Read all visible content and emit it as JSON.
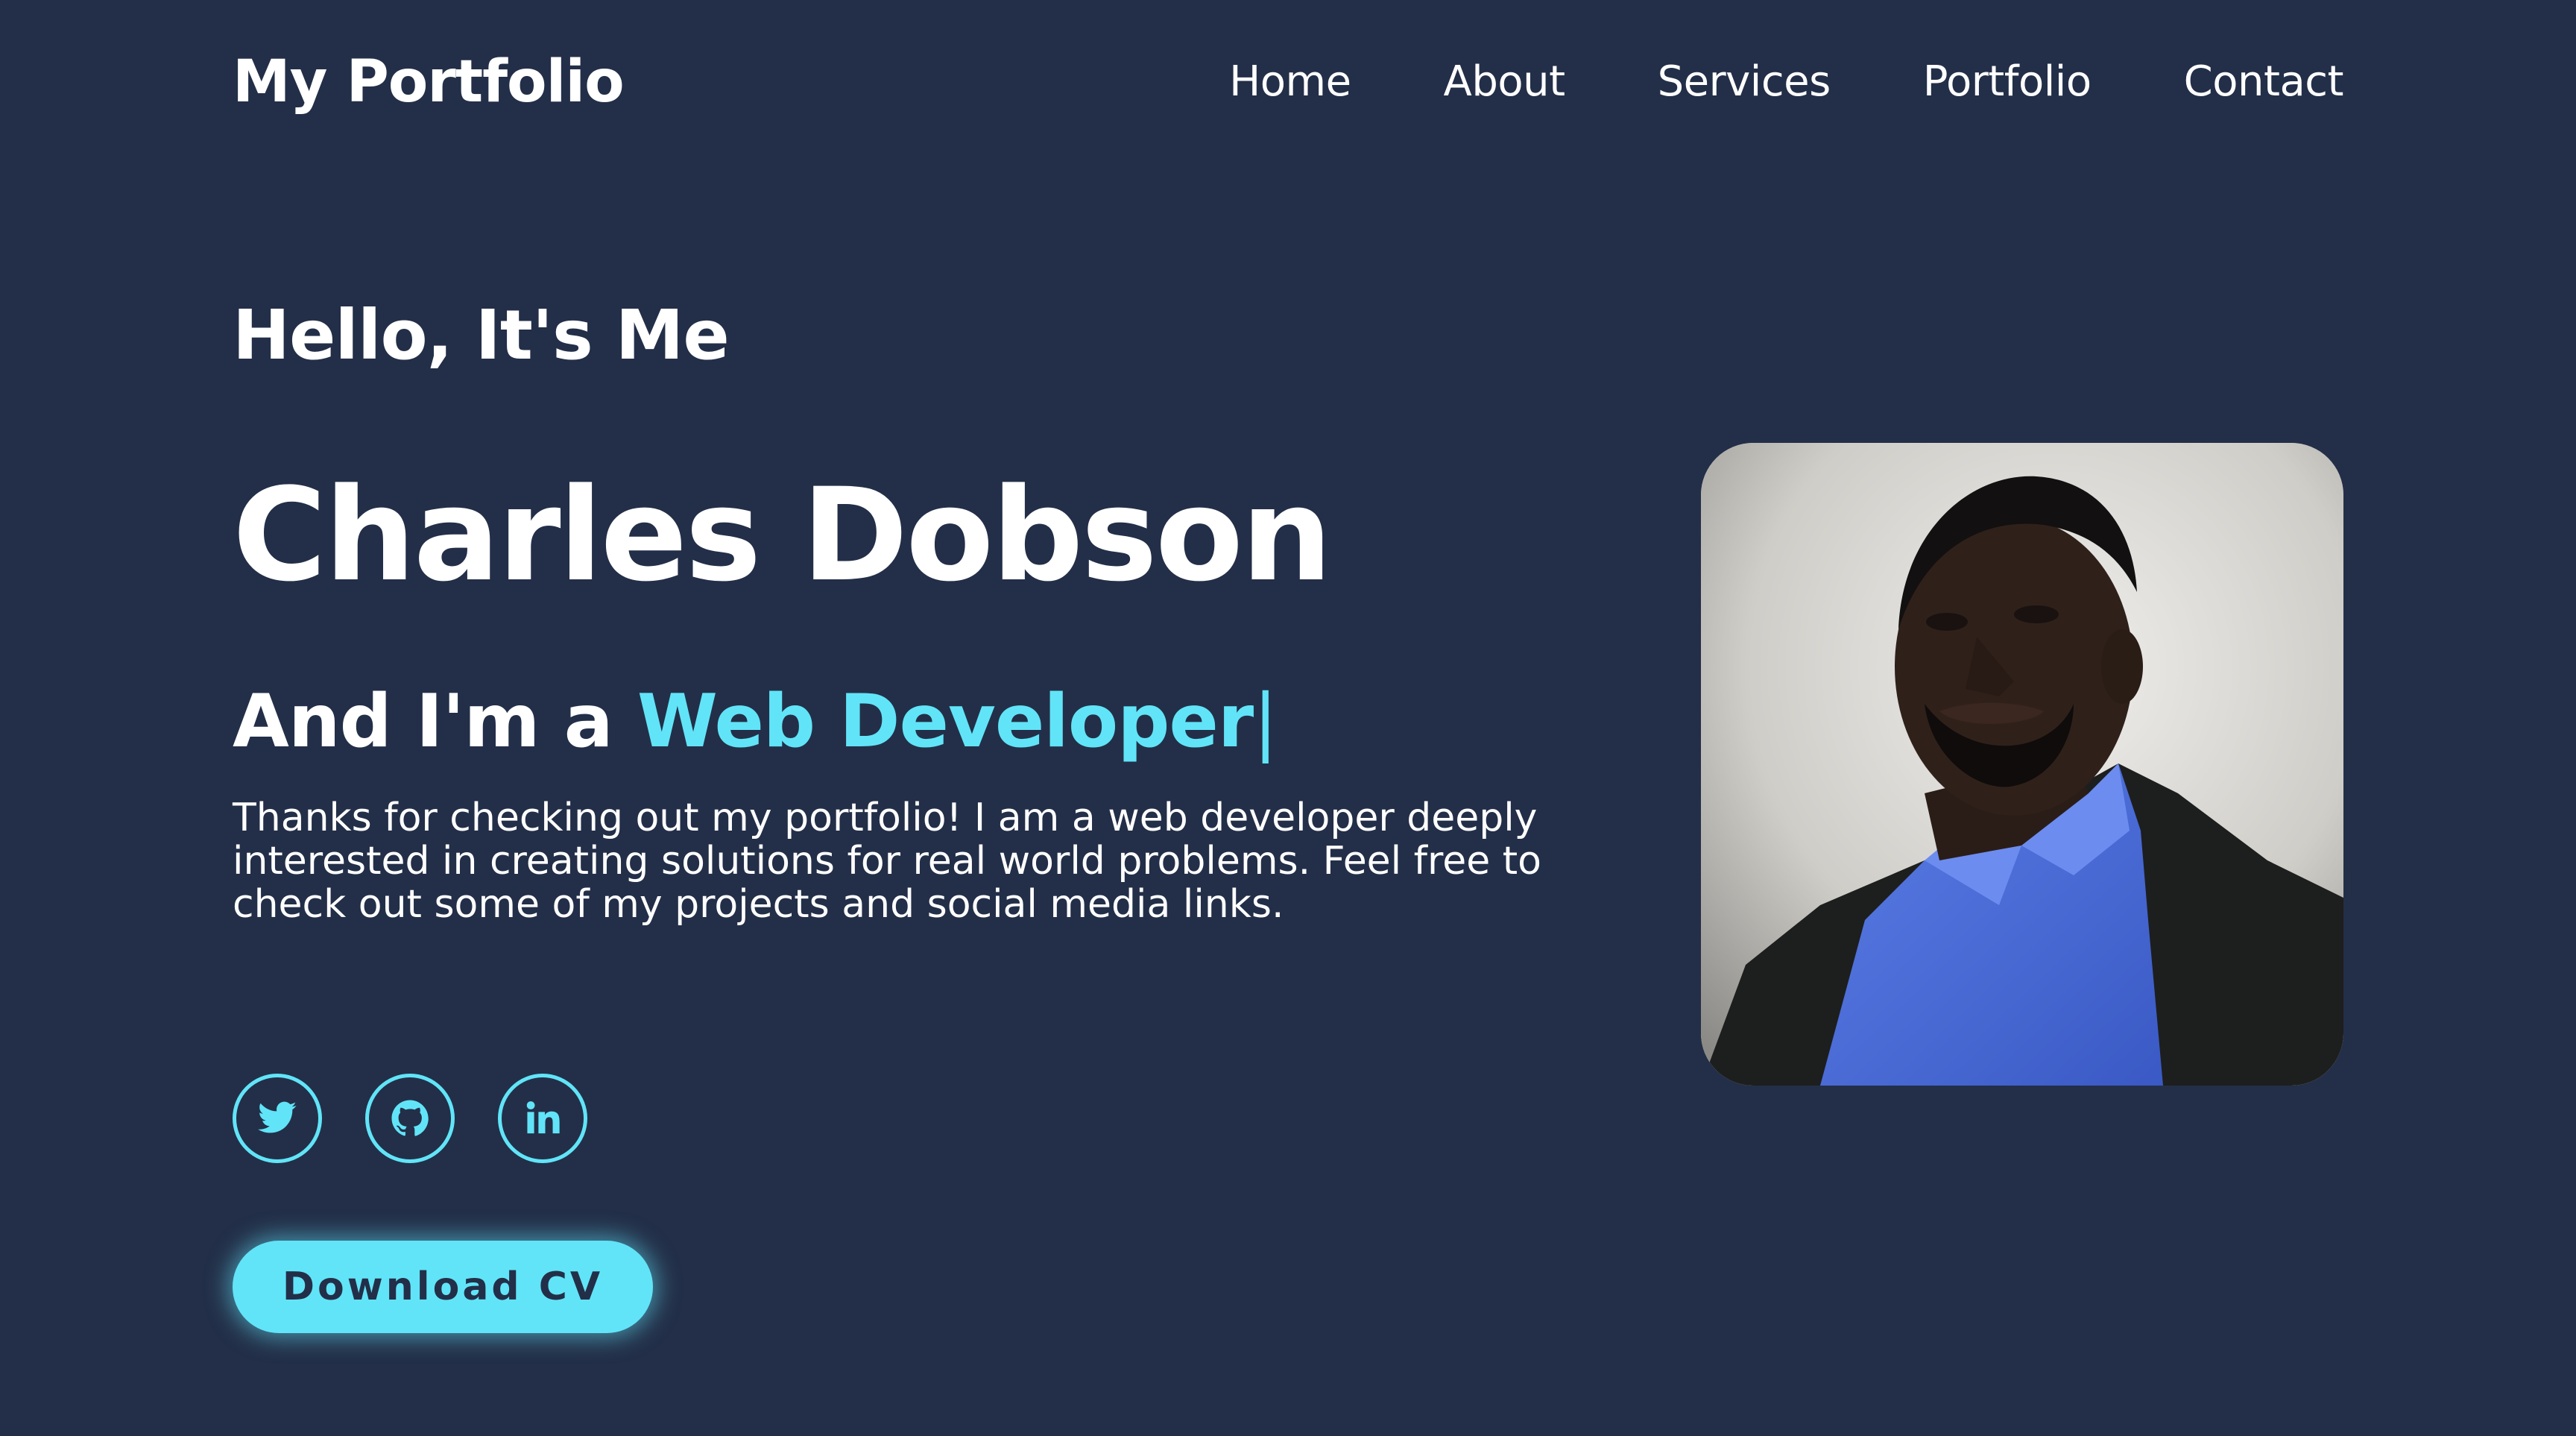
{
  "header": {
    "logo": "My Portfolio",
    "nav": [
      {
        "label": "Home"
      },
      {
        "label": "About"
      },
      {
        "label": "Services"
      },
      {
        "label": "Portfolio"
      },
      {
        "label": "Contact"
      }
    ]
  },
  "hero": {
    "greeting": "Hello, It's Me",
    "name": "Charles Dobson",
    "role_prefix": "And I'm a ",
    "role_highlight": "Web Developer",
    "cursor": "|",
    "bio": "Thanks for checking out my portfolio! I am a web developer deeply interested in creating solutions for real world problems. Feel free to check out some of my projects and social media links.",
    "download_label": "Download CV"
  },
  "socials": [
    {
      "icon": "twitter-icon"
    },
    {
      "icon": "github-icon"
    },
    {
      "icon": "linkedin-icon"
    }
  ],
  "colors": {
    "background": "#232f48",
    "accent": "#61e4f8",
    "text": "#ffffff"
  }
}
